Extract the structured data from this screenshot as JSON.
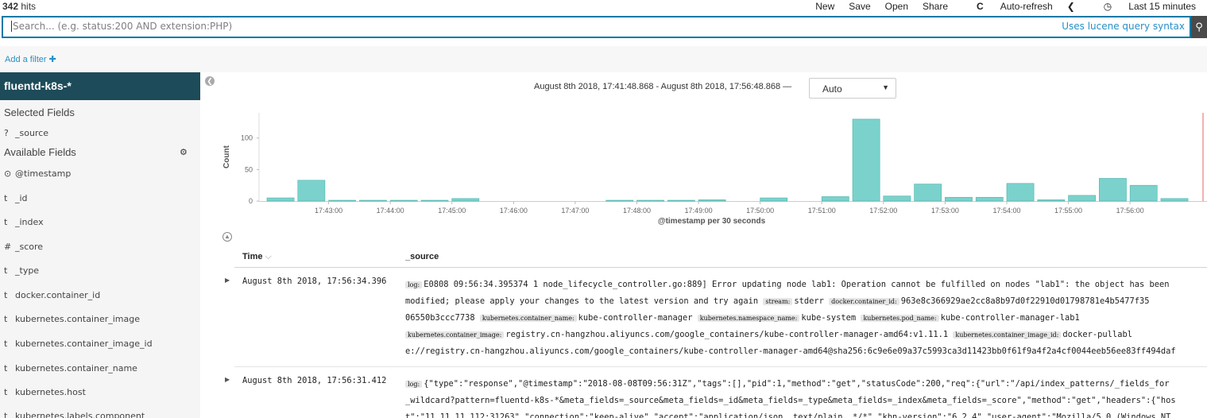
{
  "header": {
    "hits_count": "342",
    "hits_label": "hits",
    "menu": {
      "new": "New",
      "save": "Save",
      "open": "Open",
      "share": "Share",
      "auto_refresh": "Auto-refresh",
      "time_range": "Last 15 minutes"
    }
  },
  "search": {
    "placeholder": "Search... (e.g. status:200 AND extension:PHP)",
    "lucene_link": "Uses lucene query syntax"
  },
  "filter": {
    "add_label": "Add a filter"
  },
  "sidebar": {
    "index_pattern": "fluentd-k8s-*",
    "selected_title": "Selected Fields",
    "selected_fields": [
      {
        "type": "?",
        "name": "_source"
      }
    ],
    "available_title": "Available Fields",
    "available_fields": [
      {
        "type": "⊙",
        "name": "@timestamp"
      },
      {
        "type": "t",
        "name": "_id"
      },
      {
        "type": "t",
        "name": "_index"
      },
      {
        "type": "#",
        "name": "_score"
      },
      {
        "type": "t",
        "name": "_type"
      },
      {
        "type": "t",
        "name": "docker.container_id"
      },
      {
        "type": "t",
        "name": "kubernetes.container_image"
      },
      {
        "type": "t",
        "name": "kubernetes.container_image_id"
      },
      {
        "type": "t",
        "name": "kubernetes.container_name"
      },
      {
        "type": "t",
        "name": "kubernetes.host"
      },
      {
        "type": "t",
        "name": "kubernetes.labels.component"
      }
    ]
  },
  "histogram_header": {
    "range_text": "August 8th 2018, 17:41:48.868 - August 8th 2018, 17:56:48.868 —",
    "interval": "Auto"
  },
  "chart_data": {
    "type": "bar",
    "ylabel": "Count",
    "xlabel": "@timestamp per 30 seconds",
    "ylim": [
      0,
      140
    ],
    "yticks": [
      0,
      50,
      100
    ],
    "categories": [
      "17:42:00",
      "17:42:30",
      "17:43:00",
      "17:43:30",
      "17:44:00",
      "17:44:30",
      "17:45:00",
      "17:45:30",
      "17:46:00",
      "17:46:30",
      "17:47:00",
      "17:47:30",
      "17:48:00",
      "17:48:30",
      "17:49:00",
      "17:49:30",
      "17:50:00",
      "17:50:30",
      "17:51:00",
      "17:51:30",
      "17:52:00",
      "17:52:30",
      "17:53:00",
      "17:53:30",
      "17:54:00",
      "17:54:30",
      "17:55:00",
      "17:55:30",
      "17:56:00",
      "17:56:30"
    ],
    "values": [
      5,
      33,
      1,
      1,
      1,
      1,
      4,
      0,
      0,
      0,
      0,
      1,
      1,
      1,
      2,
      0,
      5,
      0,
      7,
      130,
      8,
      27,
      6,
      6,
      28,
      2,
      9,
      36,
      25,
      4
    ],
    "xtick_labels": [
      "17:43:00",
      "17:44:00",
      "17:45:00",
      "17:46:00",
      "17:47:00",
      "17:48:00",
      "17:49:00",
      "17:50:00",
      "17:51:00",
      "17:52:00",
      "17:53:00",
      "17:54:00",
      "17:55:00",
      "17:56:00"
    ],
    "bar_color": "#7bd2cd",
    "bar_stroke": "#4fb1ab",
    "now_marker_color": "#e06666"
  },
  "table": {
    "col_time": "Time",
    "col_source": "_source",
    "rows": [
      {
        "time": "August 8th 2018, 17:56:34.396",
        "lines": [
          [
            {
              "k": "log:"
            },
            {
              "v": "E0808 09:56:34.395374 1 node_lifecycle_controller.go:889] Error updating node lab1: Operation cannot be fulfilled on nodes \"lab1\": the object has been"
            }
          ],
          [
            {
              "v": "modified; please apply your changes to the latest version and try again"
            },
            {
              "k": "stream:"
            },
            {
              "v": "stderr"
            },
            {
              "k": "docker.container_id:"
            },
            {
              "v": "963e8c366929ae2cc8a8b97d0f22910d01798781e4b5477f35"
            }
          ],
          [
            {
              "v": "06550b3ccc7738"
            },
            {
              "k": "kubernetes.container_name:"
            },
            {
              "v": "kube-controller-manager"
            },
            {
              "k": "kubernetes.namespace_name:"
            },
            {
              "v": "kube-system"
            },
            {
              "k": "kubernetes.pod_name:"
            },
            {
              "v": "kube-controller-manager-lab1"
            }
          ],
          [
            {
              "k": "kubernetes.container_image:"
            },
            {
              "v": "registry.cn-hangzhou.aliyuncs.com/google_containers/kube-controller-manager-amd64:v1.11.1"
            },
            {
              "k": "kubernetes.container_image_id:"
            },
            {
              "v": "docker-pullabl"
            }
          ],
          [
            {
              "v": "e://registry.cn-hangzhou.aliyuncs.com/google_containers/kube-controller-manager-amd64@sha256:6c9e6e09a37c5993ca3d11423bb0f61f9a4f2a4cf0044eeb56ee83ff494daf"
            }
          ]
        ]
      },
      {
        "time": "August 8th 2018, 17:56:31.412",
        "lines": [
          [
            {
              "k": "log:"
            },
            {
              "v": "{\"type\":\"response\",\"@timestamp\":\"2018-08-08T09:56:31Z\",\"tags\":[],\"pid\":1,\"method\":\"get\",\"statusCode\":200,\"req\":{\"url\":\"/api/index_patterns/_fields_for"
            }
          ],
          [
            {
              "v": "_wildcard?pattern=fluentd-k8s-*&meta_fields=_source&meta_fields=_id&meta_fields=_type&meta_fields=_index&meta_fields=_score\",\"method\":\"get\",\"headers\":{\"hos"
            }
          ],
          [
            {
              "v": "t\":\"11.11.11.112:31263\",\"connection\":\"keep-alive\",\"accept\":\"application/json, text/plain, */*\",\"kbn-version\":\"6.2.4\",\"user-agent\":\"Mozilla/5.0 (Windows NT"
            }
          ]
        ]
      }
    ]
  }
}
